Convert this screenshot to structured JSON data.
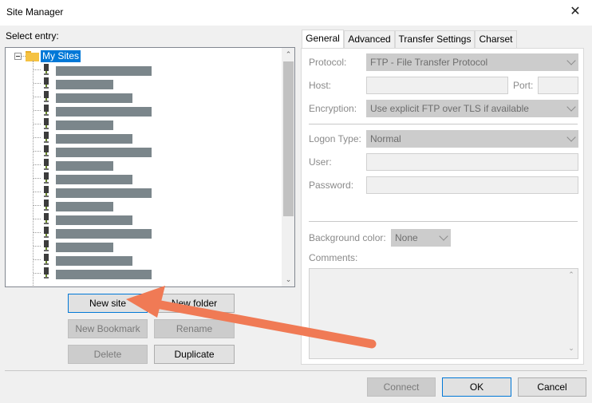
{
  "window": {
    "title": "Site Manager"
  },
  "left": {
    "select_entry_label": "Select entry:",
    "root_folder": "My Sites",
    "redacted_widths": [
      120,
      72,
      96,
      120,
      72,
      96,
      120,
      72,
      96,
      120,
      72,
      96,
      120,
      72,
      96,
      120
    ]
  },
  "buttons": {
    "new_site": "New site",
    "new_folder": "New folder",
    "new_bookmark": "New Bookmark",
    "rename": "Rename",
    "delete": "Delete",
    "duplicate": "Duplicate",
    "connect": "Connect",
    "ok": "OK",
    "cancel": "Cancel"
  },
  "tabs": [
    "General",
    "Advanced",
    "Transfer Settings",
    "Charset"
  ],
  "general": {
    "protocol_label": "Protocol:",
    "protocol_value": "FTP - File Transfer Protocol",
    "host_label": "Host:",
    "host_value": "",
    "port_label": "Port:",
    "port_value": "",
    "encryption_label": "Encryption:",
    "encryption_value": "Use explicit FTP over TLS if available",
    "logon_type_label": "Logon Type:",
    "logon_type_value": "Normal",
    "user_label": "User:",
    "user_value": "",
    "password_label": "Password:",
    "password_value": "",
    "background_color_label": "Background color:",
    "background_color_value": "None",
    "comments_label": "Comments:",
    "comments_value": ""
  },
  "colors": {
    "annotation_arrow": "#f07a55",
    "selection": "#0078d7",
    "folder": "#f5c242"
  }
}
